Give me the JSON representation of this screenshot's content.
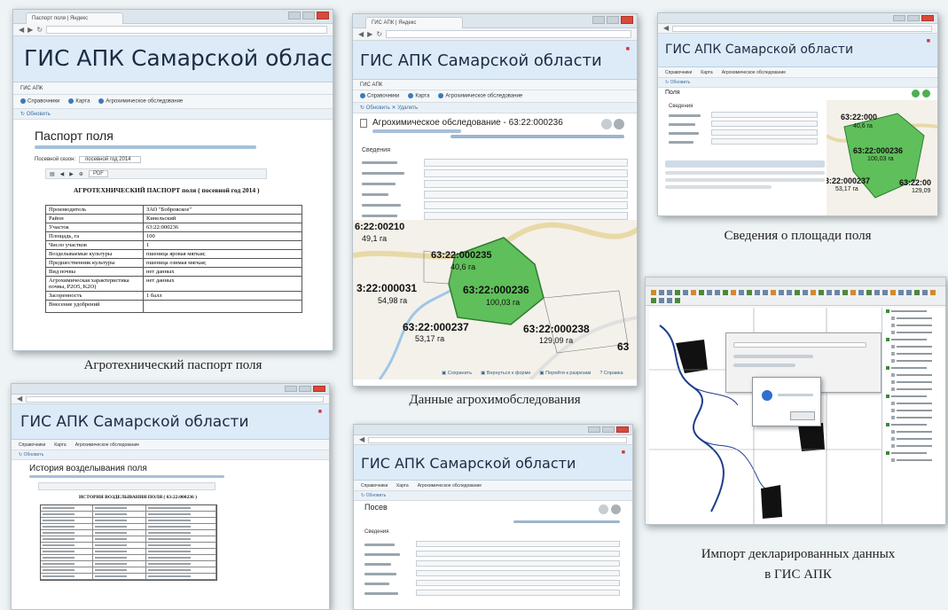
{
  "app_title": "ГИС АПК Самарской области",
  "captions": {
    "passport": "Агротехнический паспорт поля",
    "agrochem": "Данные агрохимобследования",
    "area": "Сведения о площади поля",
    "import_line1": "Импорт декларированных данных",
    "import_line2": "в ГИС АПК"
  },
  "passport": {
    "heading": "Паспорт поля",
    "year_label": "Посевной сезон:",
    "year_value": "посевной год 2014",
    "doc_title": "АГРОТЕХНИЧЕСКИЙ ПАСПОРТ поля ( посевной год 2014 )",
    "format": "PDF",
    "rows": [
      [
        "Производитель",
        "ЗАО \"Бобровское\""
      ],
      [
        "Район",
        "Кинельский"
      ],
      [
        "Участок",
        "63:22:000236"
      ],
      [
        "Площадь, га",
        "100"
      ],
      [
        "Число участков",
        "1"
      ],
      [
        "Возделываемые культуры",
        "пшеница яровая мягкая;"
      ],
      [
        "Предшественник культуры",
        "пшеница озимая мягкая;"
      ],
      [
        "Вид почвы",
        "нет данных"
      ],
      [
        "Агрохимическая характеристика почвы, P2O5, K2O)",
        "нет данных"
      ],
      [
        "Засоренность",
        "1 балл"
      ],
      [
        "Внесение удобрений",
        ""
      ]
    ]
  },
  "agrochem": {
    "heading": "Агрохимическое обследование - 63:22:000236",
    "section": "Сведения",
    "map_labels": [
      {
        "code": "63:22:000235",
        "area": "40,6 га"
      },
      {
        "code": "63:22:000236",
        "area": "100,03 га"
      },
      {
        "code": "3:22:000031",
        "area": "54,98 га"
      },
      {
        "code": "63:22:000237",
        "area": "53,17 га"
      },
      {
        "code": "63:22:000238",
        "area": "129,09 га"
      },
      {
        "code": "6:22:00210",
        "area": "49,1 га"
      },
      {
        "code": "63",
        "area": ""
      }
    ]
  },
  "area": {
    "heading": "Поля",
    "section": "Сведения",
    "map_labels": [
      {
        "code": "63:22:000",
        "area": "40,6 га"
      },
      {
        "code": "63:22:000236",
        "area": "100,03 га"
      },
      {
        "code": "3:22:000237",
        "area": "53,17 га"
      },
      {
        "code": "63:22:00",
        "area": "129,09"
      }
    ]
  },
  "history": {
    "heading": "История возделывания поля",
    "doc_title": "ИСТОРИЯ ВОЗДЕЛЫВАНИЯ ПОЛЯ ( 63:22:000236 )"
  },
  "sowing": {
    "heading": "Посев",
    "section": "Сведения"
  },
  "colors": {
    "banner": "#dcebf7",
    "parcel_green": "#5fbf5a",
    "title_dark": "#1d2b44",
    "background": "#eef4f6"
  }
}
